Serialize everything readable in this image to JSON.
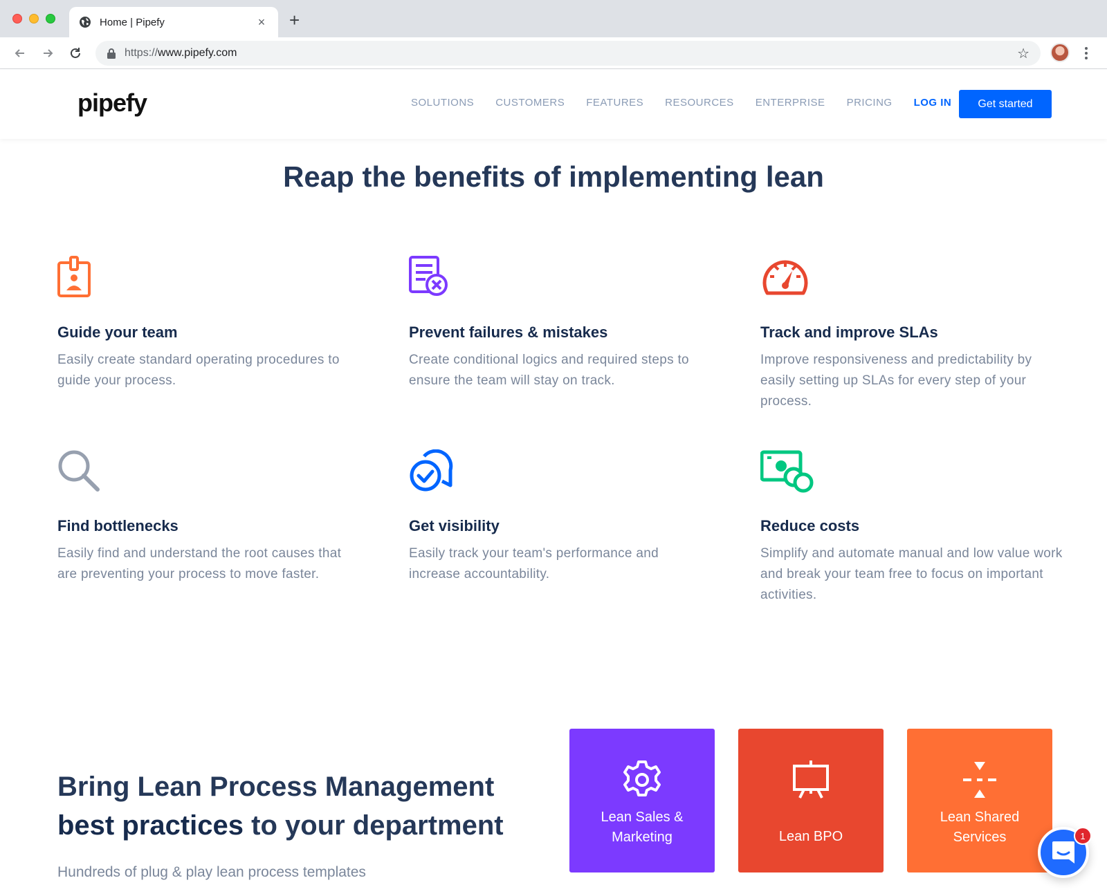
{
  "browser": {
    "tab_title": "Home | Pipefy",
    "new_tab_label": "+",
    "close_label": "×",
    "url_scheme": "https://",
    "url_host": "www.pipefy.com"
  },
  "header": {
    "logo": "pipefy",
    "nav": [
      "SOLUTIONS",
      "CUSTOMERS",
      "FEATURES",
      "RESOURCES",
      "ENTERPRISE",
      "PRICING"
    ],
    "login": "LOG IN",
    "cta": "Get started"
  },
  "benefits": {
    "title_regular": "Reap the benefits of ",
    "title_bold": "implementing lean",
    "items": [
      {
        "icon": "id-badge-icon",
        "color": "#ff6f34",
        "title": "Guide your team",
        "text": "Easily create standard operating procedures to guide your process."
      },
      {
        "icon": "checklist-x-icon",
        "color": "#7c3aff",
        "title": "Prevent failures & mistakes",
        "text": "Create conditional logics and required steps to ensure the team will stay on track."
      },
      {
        "icon": "speedometer-icon",
        "color": "#e8472f",
        "title": "Track and improve SLAs",
        "text": "Improve responsiveness and predictability by easily setting up SLAs for every step of your process."
      },
      {
        "icon": "magnifier-icon",
        "color": "#97a0af",
        "title": "Find bottlenecks",
        "text": "Easily find and understand the root causes that are preventing your process to move faster."
      },
      {
        "icon": "chat-check-icon",
        "color": "#0065ff",
        "title": "Get visibility",
        "text": "Easily track your team's performance and increase accountability."
      },
      {
        "icon": "money-coins-icon",
        "color": "#00c781",
        "title": "Reduce costs",
        "text": "Simplify and automate manual and low value work and break your team free to focus on important activities."
      }
    ]
  },
  "bring": {
    "line1": "Bring Lean Process Management",
    "bold": "best practices",
    "line2_rest": " to your department",
    "subtitle": "Hundreds of plug & play lean process templates"
  },
  "cards": [
    {
      "icon": "gear-icon",
      "color": "#7c3aff",
      "label": "Lean Sales & Marketing"
    },
    {
      "icon": "presentation-board-icon",
      "color": "#e8472f",
      "label": "Lean BPO"
    },
    {
      "icon": "divide-icon",
      "color": "#ff6f34",
      "label": "Lean Shared Services"
    }
  ],
  "chat": {
    "badge": "1"
  }
}
